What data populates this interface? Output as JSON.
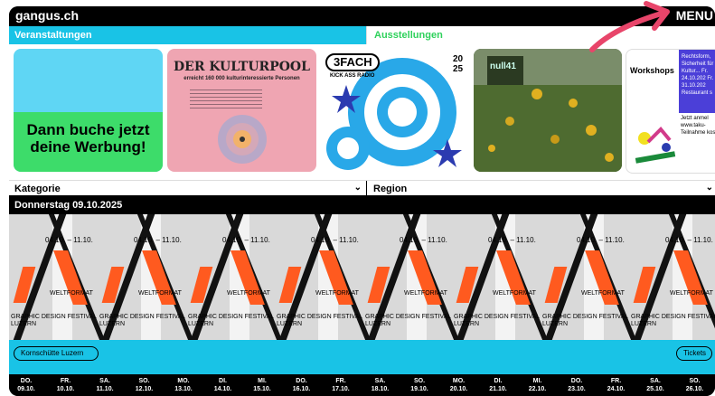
{
  "header": {
    "site_title": "gangus.ch",
    "menu_label": "MENU"
  },
  "tabs": {
    "events_label": "Veranstaltungen",
    "exhibitions_label": "Ausstellungen"
  },
  "ads": {
    "ad1_text": "Dann buche jetzt deine Werbung!",
    "ad2_title": "DER KULTURPOOL",
    "ad2_subtitle": "erreicht 160 000 kulturinteressierte Personen",
    "ad3_title": "3FACH",
    "ad3_subtitle": "KICK ASS RADIO",
    "ad3_year": "20 25",
    "ad4_title": "null41",
    "ad5_title": "Workshops",
    "ad5_box": "Rechtsform, Sicherheit für Kultur... Fr. 24.10.202 Fr. 31.10.202 Restaurant s",
    "ad5_footer": "Jetzt anmel www.taku- Teilnahme kos"
  },
  "filters": {
    "category_label": "Kategorie",
    "region_label": "Region"
  },
  "date_header": "Donnerstag 09.10.2025",
  "event": {
    "poster_dates": "04.10. – 11.10.",
    "poster_word": "WELTFORMAT",
    "poster_subtitle": "GRAPHIC DESIGN FESTIVAL LUZERN",
    "location": "Kornschütte Luzern",
    "tickets": "Tickets"
  },
  "days": [
    {
      "dow": "DO.",
      "date": "09.10."
    },
    {
      "dow": "FR.",
      "date": "10.10."
    },
    {
      "dow": "SA.",
      "date": "11.10."
    },
    {
      "dow": "SO.",
      "date": "12.10."
    },
    {
      "dow": "MO.",
      "date": "13.10."
    },
    {
      "dow": "DI.",
      "date": "14.10."
    },
    {
      "dow": "MI.",
      "date": "15.10."
    },
    {
      "dow": "DO.",
      "date": "16.10."
    },
    {
      "dow": "FR.",
      "date": "17.10."
    },
    {
      "dow": "SA.",
      "date": "18.10."
    },
    {
      "dow": "SO.",
      "date": "19.10."
    },
    {
      "dow": "MO.",
      "date": "20.10."
    },
    {
      "dow": "DI.",
      "date": "21.10."
    },
    {
      "dow": "MI.",
      "date": "22.10."
    },
    {
      "dow": "DO.",
      "date": "23.10."
    },
    {
      "dow": "FR.",
      "date": "24.10."
    },
    {
      "dow": "SA.",
      "date": "25.10."
    },
    {
      "dow": "SO.",
      "date": "26.10."
    }
  ],
  "colors": {
    "cyan": "#19c3e6",
    "green": "#2ed15b",
    "orange": "#ff5a1f",
    "arrow": "#e8456a"
  }
}
